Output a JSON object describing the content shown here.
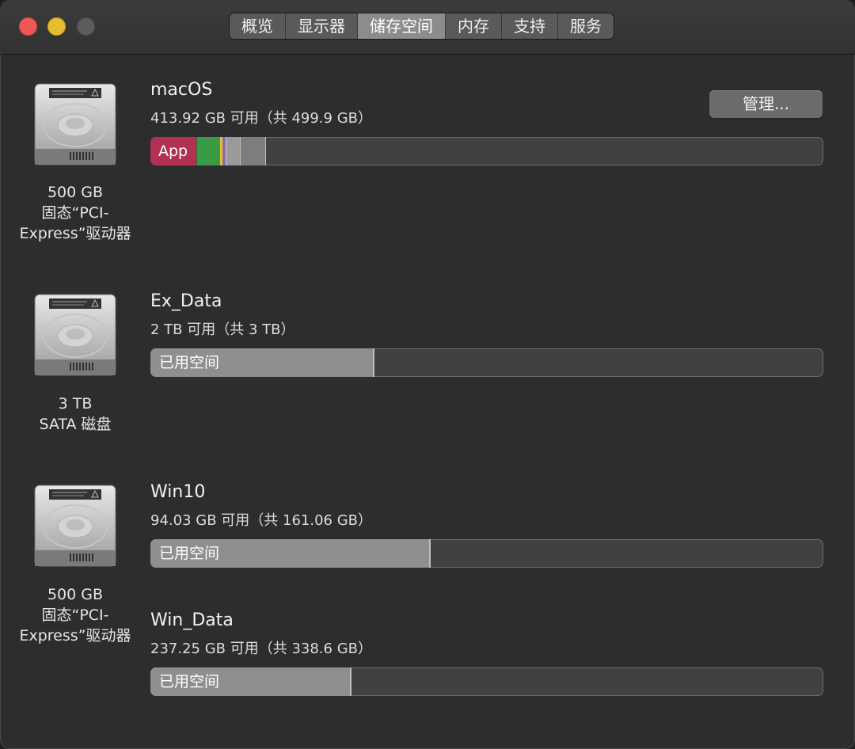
{
  "tabs": [
    "概览",
    "显示器",
    "储存空间",
    "内存",
    "支持",
    "服务"
  ],
  "active_tab": "储存空间",
  "manage_label": "管理...",
  "drives": [
    {
      "icon": "hard-drive-icon",
      "caption": [
        "500 GB",
        "固态“PCI-",
        "Express”驱动器"
      ],
      "volumes": [
        {
          "name": "macOS",
          "avail": "413.92 GB 可用（共 499.9 GB）",
          "segments": [
            {
              "label": "App",
              "color": "#b23152"
            },
            {
              "label": "",
              "color": "#3b9a45"
            },
            {
              "label": "",
              "color": "#e5c32a"
            },
            {
              "label": "",
              "color": "#8c6aa8"
            },
            {
              "label": "",
              "color": "#9a9a9a"
            },
            {
              "label": "",
              "color": "#7d7d7d"
            }
          ]
        }
      ]
    },
    {
      "icon": "hard-drive-icon",
      "caption": [
        "3 TB",
        "SATA 磁盘"
      ],
      "volumes": [
        {
          "name": "Ex_Data",
          "avail": "2 TB 可用（共 3 TB）",
          "used_label": "已用空间",
          "used_fraction": 0.333
        }
      ]
    },
    {
      "icon": "hard-drive-icon",
      "caption": [
        "500 GB",
        "固态“PCI-",
        "Express”驱动器"
      ],
      "volumes": [
        {
          "name": "Win10",
          "avail": "94.03 GB 可用（共 161.06 GB）",
          "used_label": "已用空间",
          "used_fraction": 0.416
        },
        {
          "name": "Win_Data",
          "avail": "237.25 GB 可用（共 338.6 GB）",
          "used_label": "已用空间",
          "used_fraction": 0.299
        }
      ]
    }
  ],
  "colors": {
    "accent_app": "#b23152",
    "traffic_close": "#ee5a53",
    "traffic_min": "#e6bd2f"
  }
}
